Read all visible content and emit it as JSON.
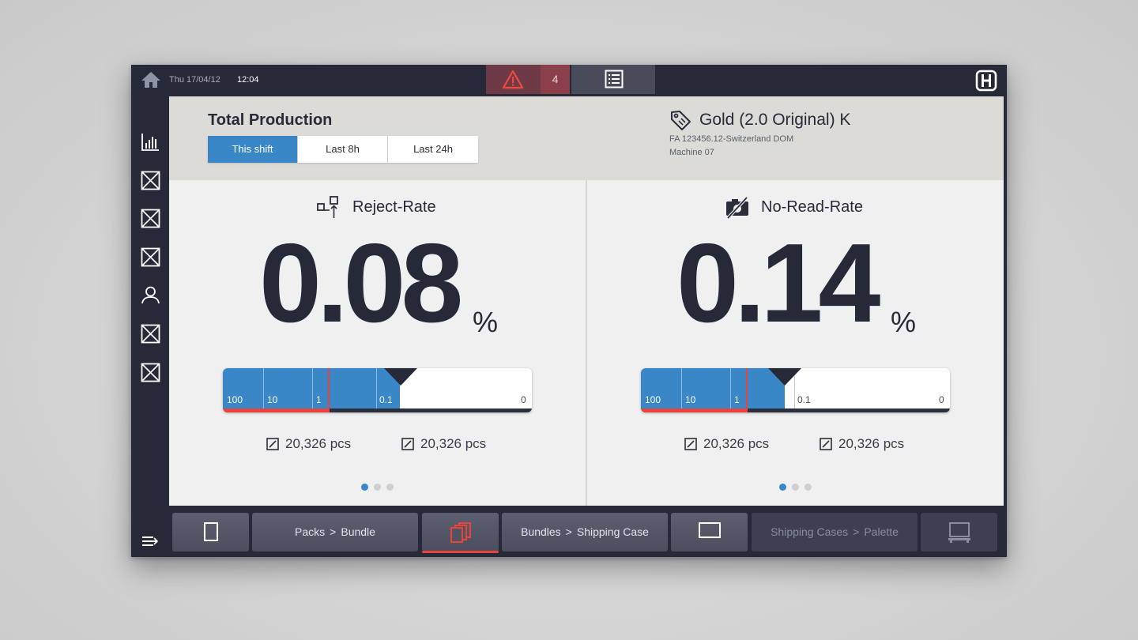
{
  "topbar": {
    "date": "Thu 17/04/12",
    "time": "12:04",
    "alert_count": "4"
  },
  "header": {
    "title": "Total Production",
    "segments": [
      "This shift",
      "Last 8h",
      "Last 24h"
    ],
    "product_name": "Gold (2.0 Original) K",
    "product_code": "FA 123456.12-Switzerland  DOM",
    "machine": "Machine 07"
  },
  "panels": [
    {
      "title": "Reject-Rate",
      "value": "0.08",
      "unit": "%",
      "gauge_labels": [
        "100",
        "10",
        "1",
        "0.1",
        "0"
      ],
      "counts": [
        "20,326 pcs",
        "20,326 pcs"
      ]
    },
    {
      "title": "No-Read-Rate",
      "value": "0.14",
      "unit": "%",
      "gauge_labels": [
        "100",
        "10",
        "1",
        "0.1",
        "0"
      ],
      "counts": [
        "20,326 pcs",
        "20,326 pcs"
      ]
    }
  ],
  "bottomnav": {
    "step1_from": "Packs",
    "step1_to": "Bundle",
    "step2_from": "Bundles",
    "step2_to": "Shipping Case",
    "step3_from": "Shipping Cases",
    "step3_to": "Palette",
    "sep": ">"
  },
  "colors": {
    "accent": "#3a87c8",
    "alert": "#e8443a",
    "frame": "#262937"
  }
}
